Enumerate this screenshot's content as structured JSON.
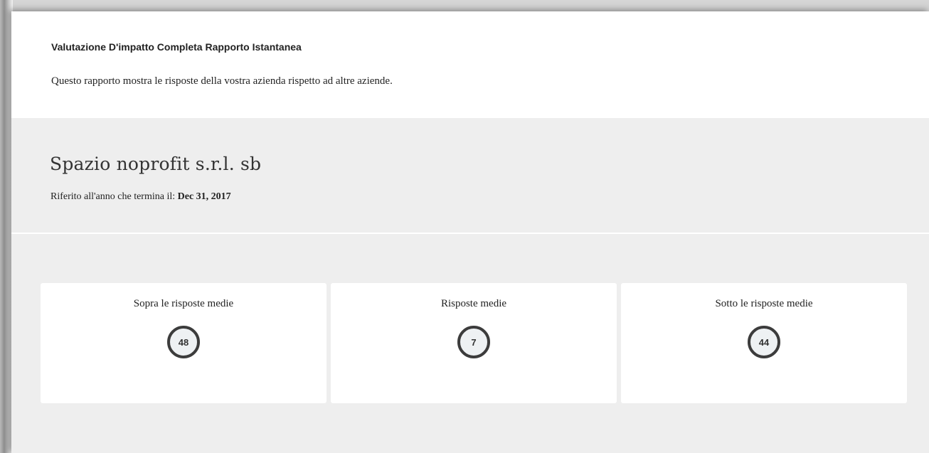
{
  "report": {
    "title": "Valutazione D'impatto Completa Rapporto Istantanea",
    "description": "Questo rapporto mostra le risposte della vostra azienda rispetto ad altre aziende."
  },
  "company": {
    "name": "Spazio noprofit s.r.l. sb",
    "year_label": "Riferito all'anno che termina il:",
    "year_value": "Dec 31, 2017"
  },
  "cards": [
    {
      "title": "Sopra le risposte medie",
      "count": "48"
    },
    {
      "title": "Risposte medie",
      "count": "7"
    },
    {
      "title": "Sotto le risposte medie",
      "count": "44"
    }
  ],
  "colors": {
    "band_background": "#eeeeee",
    "card_background": "#ffffff",
    "circle_border": "#3c3c3c",
    "circle_fill": "#eef1f3"
  }
}
